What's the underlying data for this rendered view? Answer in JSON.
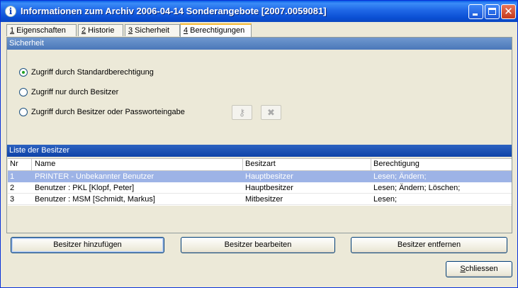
{
  "window": {
    "title": "Informationen zum Archiv  2006-04-14 Sonderangebote [2007.0059081]",
    "icon": "info-icon"
  },
  "tabs": [
    {
      "num": "1",
      "label": " Eigenschaften"
    },
    {
      "num": "2",
      "label": " Historie"
    },
    {
      "num": "3",
      "label": " Sicherheit"
    },
    {
      "num": "4",
      "label": " Berechtigungen"
    }
  ],
  "active_tab": "Berechtigungen",
  "security": {
    "header": "Sicherheit",
    "options": [
      {
        "label": "Zugriff durch Standardberechtigung",
        "selected": true
      },
      {
        "label": "Zugriff nur durch Besitzer",
        "selected": false
      },
      {
        "label": "Zugriff durch Besitzer oder Passworteingabe",
        "selected": false
      }
    ],
    "icon_buttons": [
      "key-icon",
      "remove-key-icon"
    ]
  },
  "owners": {
    "header": "Liste der Besitzer",
    "columns": [
      "Nr",
      "Name",
      "Besitzart",
      "Berechtigung"
    ],
    "rows": [
      {
        "nr": "1",
        "name": "PRINTER - Unbekannter Benutzer",
        "art": "Hauptbesitzer",
        "rights": "Lesen; Ändern;",
        "selected": true
      },
      {
        "nr": "2",
        "name": "Benutzer : PKL [Klopf, Peter]",
        "art": "Hauptbesitzer",
        "rights": "Lesen; Ändern; Löschen;",
        "selected": false
      },
      {
        "nr": "3",
        "name": "Benutzer : MSM [Schmidt, Markus]",
        "art": "Mitbesitzer",
        "rights": "Lesen;",
        "selected": false
      }
    ]
  },
  "buttons": {
    "add": "Besitzer hinzufügen",
    "edit": "Besitzer bearbeiten",
    "remove": "Besitzer entfernen",
    "close_prefix": "S",
    "close_rest": "chliessen"
  },
  "colors": {
    "titlebar": "#0a5fe6",
    "selected_row": "#9db3e6",
    "section_header": "#4b77b9",
    "radio_dot": "#21a121"
  }
}
